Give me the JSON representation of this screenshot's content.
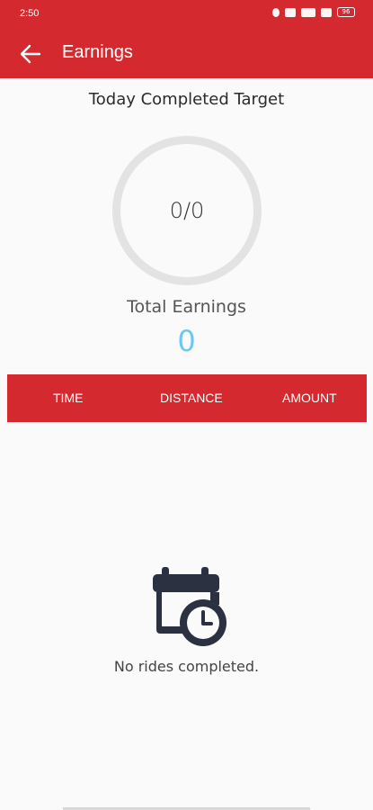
{
  "status_bar": {
    "time": "2:50",
    "battery": "96"
  },
  "app_bar": {
    "title": "Earnings",
    "back_icon": "arrow-left-icon"
  },
  "target": {
    "label": "Today Completed Target",
    "value": "0/0"
  },
  "earnings": {
    "label": "Total Earnings",
    "value": "0"
  },
  "table": {
    "columns": [
      "TIME",
      "DISTANCE",
      "AMOUNT"
    ]
  },
  "empty_state": {
    "icon": "calendar-clock-icon",
    "message": "No rides completed."
  },
  "colors": {
    "primary": "#d42a2f",
    "earnings_value": "#6dc7f0"
  }
}
